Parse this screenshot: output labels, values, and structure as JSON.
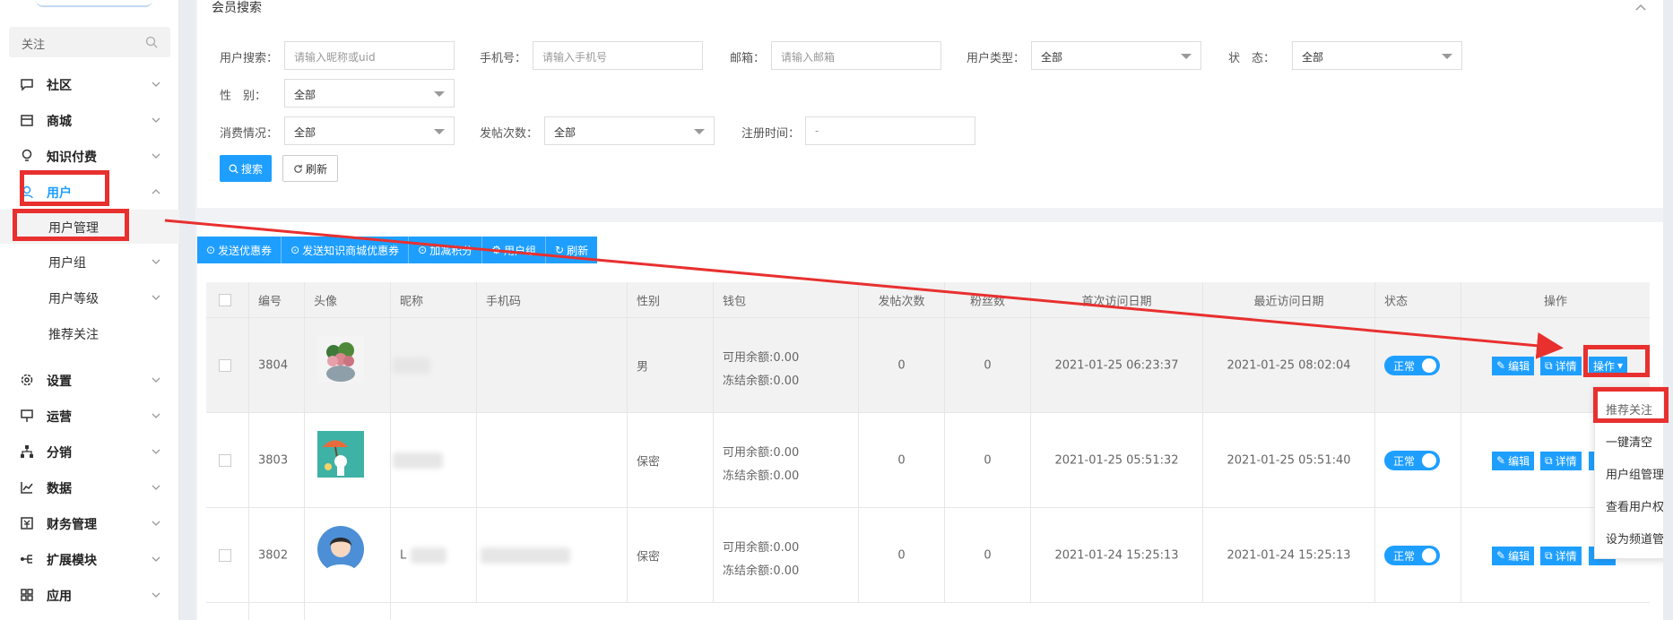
{
  "sidebar": {
    "search_placeholder": "关注",
    "menu": [
      {
        "label": "社区",
        "icon": "chat-icon"
      },
      {
        "label": "商城",
        "icon": "shop-icon"
      },
      {
        "label": "知识付费",
        "icon": "bulb-icon"
      },
      {
        "label": "用户",
        "icon": "user-icon"
      },
      {
        "label": "设置",
        "icon": "gear-icon"
      },
      {
        "label": "运营",
        "icon": "presentation-icon"
      },
      {
        "label": "分销",
        "icon": "network-icon"
      },
      {
        "label": "数据",
        "icon": "chart-icon"
      },
      {
        "label": "财务管理",
        "icon": "finance-icon"
      },
      {
        "label": "扩展模块",
        "icon": "extension-icon"
      },
      {
        "label": "应用",
        "icon": "grid-icon"
      }
    ],
    "user_sub": [
      "用户管理",
      "用户组",
      "用户等级",
      "推荐关注"
    ]
  },
  "search_panel": {
    "title": "会员搜索",
    "user_search_label": "用户搜索：",
    "user_search_placeholder": "请输入昵称或uid",
    "phone_label": "手机号：",
    "phone_placeholder": "请输入手机号",
    "email_label": "邮箱：",
    "email_placeholder": "请输入邮箱",
    "user_type_label": "用户类型：",
    "user_type_value": "全部",
    "status_label": "状　态：",
    "status_value": "全部",
    "gender_label": "性　别：",
    "gender_value": "全部",
    "consume_label": "消费情况：",
    "consume_value": "全部",
    "posts_label": "发帖次数：",
    "posts_value": "全部",
    "reg_label": "注册时间：",
    "reg_value": " - ",
    "search_button": "搜索",
    "refresh_button": "刷新"
  },
  "toolbar": [
    "发送优惠券",
    "发送知识商城优惠券",
    "加减积分",
    "用户组",
    "刷新"
  ],
  "table": {
    "headers": [
      "编号",
      "头像",
      "昵称",
      "手机码",
      "性别",
      "钱包",
      "发帖次数",
      "粉丝数",
      "首次访问日期",
      "最近访问日期",
      "状态",
      "操作"
    ],
    "rows": [
      {
        "id": "3804",
        "gender": "男",
        "wallet1": "可用余额:0.00",
        "wallet2": "冻结余额:0.00",
        "posts": "0",
        "fans": "0",
        "first": "2021-01-25 06:23:37",
        "last": "2021-01-25 08:02:04",
        "status": "正常"
      },
      {
        "id": "3803",
        "gender": "保密",
        "wallet1": "可用余额:0.00",
        "wallet2": "冻结余额:0.00",
        "posts": "0",
        "fans": "0",
        "first": "2021-01-25 05:51:32",
        "last": "2021-01-25 05:51:40",
        "status": "正常"
      },
      {
        "id": "3802",
        "gender": "保密",
        "wallet1": "可用余额:0.00",
        "wallet2": "冻结余额:0.00",
        "posts": "0",
        "fans": "0",
        "first": "2021-01-24 15:25:13",
        "last": "2021-01-24 15:25:13",
        "status": "正常"
      }
    ],
    "nickname_3802_first_char": "L",
    "edit_label": "编辑",
    "detail_label": "详情",
    "op_label": "操作"
  },
  "dropdown": [
    "推荐关注",
    "一键清空",
    "用户组管理",
    "查看用户权限",
    "设为频道管理"
  ],
  "colors": {
    "primary": "#1e9fff",
    "highlight": "#e8302f"
  }
}
